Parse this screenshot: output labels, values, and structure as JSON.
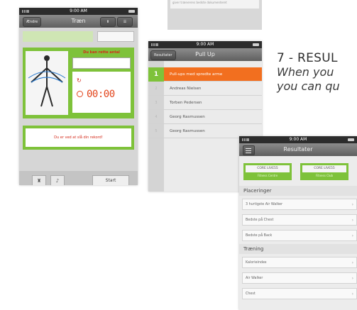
{
  "top_fragment": {
    "text": "giver trænerens bedste dokumenteret"
  },
  "heading": {
    "title": "7 - RESUL",
    "line1": "When you",
    "line2": "you can qu"
  },
  "phone1": {
    "time": "9:00 AM",
    "back_label": "Ændre",
    "title": "Træn",
    "message": "Du kan rette antal",
    "timer": "00:00",
    "record_text": "Du er ved at slå din rekord!",
    "start_label": "Start",
    "trophy_icon": "trophy-icon",
    "sound_icon": "speaker-icon"
  },
  "phone2": {
    "time": "9:00 AM",
    "back_label": "Resultater",
    "title": "Pull Up",
    "rows": [
      {
        "num": "1",
        "name": "Pull-ups med spredte arme",
        "active": true
      },
      {
        "num": "2",
        "name": "Andreas Nielsen"
      },
      {
        "num": "3",
        "name": "Torben Pedersen"
      },
      {
        "num": "4",
        "name": "Georg Rasmussen"
      },
      {
        "num": "5",
        "name": "Georg Rasmussen"
      }
    ]
  },
  "phone3": {
    "time": "9:00 AM",
    "title": "Resultater",
    "banners": [
      {
        "logo": "CORE LIVE55",
        "sub": "Fitness Centre"
      },
      {
        "logo": "CORE LIVE55",
        "sub": "Fitness Club"
      }
    ],
    "sections": [
      {
        "title": "Placeringer",
        "rows": [
          "3 hurtigste Air Walker",
          "Bedste på Chest",
          "Bedste på Back"
        ]
      },
      {
        "title": "Træning",
        "rows": [
          "Kalorieindex",
          "Air Walker",
          "Chest"
        ]
      }
    ],
    "chevron": "›"
  },
  "colors": {
    "green": "#7ec23a",
    "orange": "#f26f1f",
    "red": "#d42a1a"
  }
}
